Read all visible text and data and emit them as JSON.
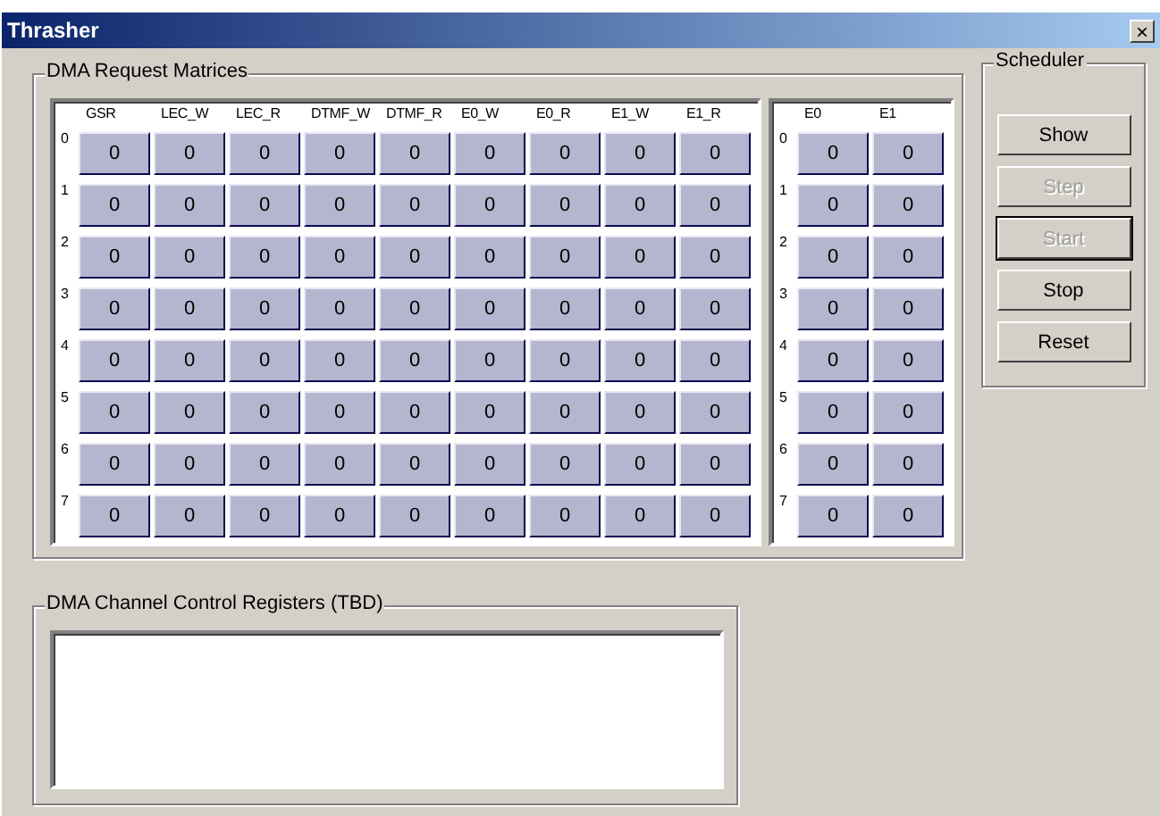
{
  "window": {
    "title": "Thrasher",
    "close": "×"
  },
  "request_group": {
    "title": "DMA Request Matrices",
    "matrices": [
      {
        "columns": [
          "GSR",
          "LEC_W",
          "LEC_R",
          "DTMF_W",
          "DTMF_R",
          "E0_W",
          "E0_R",
          "E1_W",
          "E1_R"
        ],
        "rows": [
          {
            "label": "0",
            "cells": [
              "0",
              "0",
              "0",
              "0",
              "0",
              "0",
              "0",
              "0",
              "0"
            ]
          },
          {
            "label": "1",
            "cells": [
              "0",
              "0",
              "0",
              "0",
              "0",
              "0",
              "0",
              "0",
              "0"
            ]
          },
          {
            "label": "2",
            "cells": [
              "0",
              "0",
              "0",
              "0",
              "0",
              "0",
              "0",
              "0",
              "0"
            ]
          },
          {
            "label": "3",
            "cells": [
              "0",
              "0",
              "0",
              "0",
              "0",
              "0",
              "0",
              "0",
              "0"
            ]
          },
          {
            "label": "4",
            "cells": [
              "0",
              "0",
              "0",
              "0",
              "0",
              "0",
              "0",
              "0",
              "0"
            ]
          },
          {
            "label": "5",
            "cells": [
              "0",
              "0",
              "0",
              "0",
              "0",
              "0",
              "0",
              "0",
              "0"
            ]
          },
          {
            "label": "6",
            "cells": [
              "0",
              "0",
              "0",
              "0",
              "0",
              "0",
              "0",
              "0",
              "0"
            ]
          },
          {
            "label": "7",
            "cells": [
              "0",
              "0",
              "0",
              "0",
              "0",
              "0",
              "0",
              "0",
              "0"
            ]
          }
        ]
      },
      {
        "columns": [
          "E0",
          "E1"
        ],
        "rows": [
          {
            "label": "0",
            "cells": [
              "0",
              "0"
            ]
          },
          {
            "label": "1",
            "cells": [
              "0",
              "0"
            ]
          },
          {
            "label": "2",
            "cells": [
              "0",
              "0"
            ]
          },
          {
            "label": "3",
            "cells": [
              "0",
              "0"
            ]
          },
          {
            "label": "4",
            "cells": [
              "0",
              "0"
            ]
          },
          {
            "label": "5",
            "cells": [
              "0",
              "0"
            ]
          },
          {
            "label": "6",
            "cells": [
              "0",
              "0"
            ]
          },
          {
            "label": "7",
            "cells": [
              "0",
              "0"
            ]
          }
        ]
      }
    ]
  },
  "scheduler": {
    "title": "Scheduler",
    "buttons": [
      {
        "label": "Show",
        "disabled": false,
        "focused": false
      },
      {
        "label": "Step",
        "disabled": true,
        "focused": false
      },
      {
        "label": "Start",
        "disabled": true,
        "focused": true
      },
      {
        "label": "Stop",
        "disabled": false,
        "focused": false
      },
      {
        "label": "Reset",
        "disabled": false,
        "focused": false
      }
    ]
  },
  "registers_group": {
    "title": "DMA Channel Control Registers (TBD)"
  }
}
